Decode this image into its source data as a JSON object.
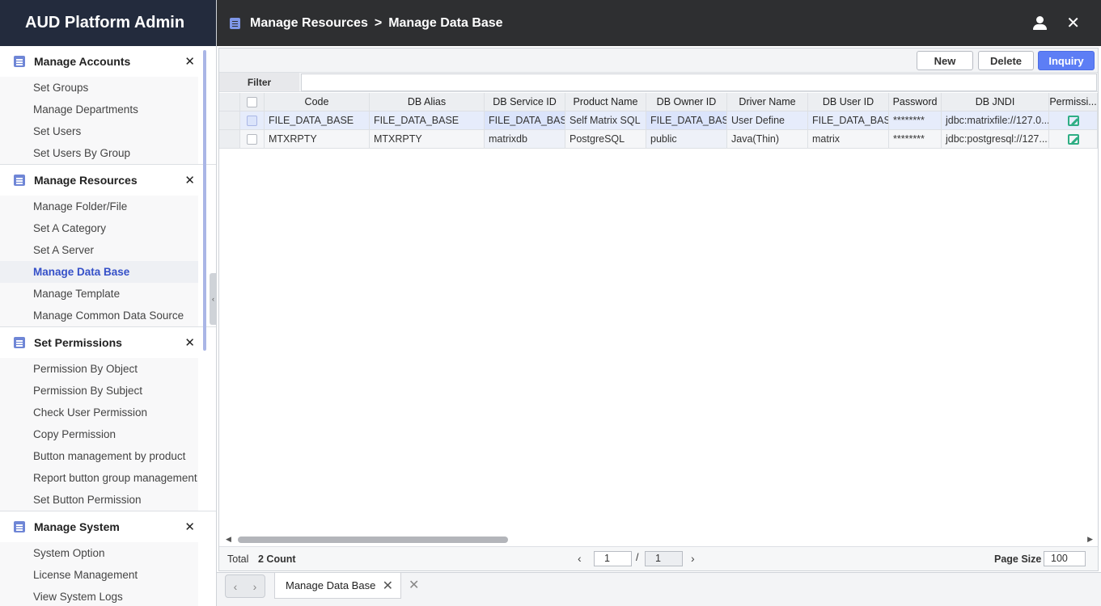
{
  "app": {
    "title": "AUD Platform Admin"
  },
  "header": {
    "breadcrumb": [
      "Manage Resources",
      "Manage Data Base"
    ],
    "separator": ">",
    "icons": {
      "user": "user-icon",
      "close": "close-icon"
    }
  },
  "sidebar": {
    "groups": [
      {
        "title": "Manage Accounts",
        "items": [
          "Set Groups",
          "Manage Departments",
          "Set Users",
          "Set Users By Group"
        ]
      },
      {
        "title": "Manage Resources",
        "items": [
          "Manage Folder/File",
          "Set A Category",
          "Set A Server",
          "Manage Data Base",
          "Manage Template",
          "Manage Common Data Source"
        ]
      },
      {
        "title": "Set Permissions",
        "items": [
          "Permission By Object",
          "Permission By Subject",
          "Check User Permission",
          "Copy Permission",
          "Button management by product",
          "Report button group management",
          "Set Button Permission"
        ]
      },
      {
        "title": "Manage System",
        "items": [
          "System Option",
          "License Management",
          "View System Logs"
        ]
      }
    ],
    "active_item": "Manage Data Base",
    "close_glyph": "✕"
  },
  "toolbar": {
    "new_label": "New",
    "delete_label": "Delete",
    "inquiry_label": "Inquiry"
  },
  "filter": {
    "label": "Filter",
    "value": ""
  },
  "grid": {
    "columns": [
      "",
      "",
      "Code",
      "DB Alias",
      "DB Service ID",
      "Product Name",
      "DB Owner ID",
      "Driver Name",
      "DB User ID",
      "Password",
      "DB JNDI",
      "Permissi..."
    ],
    "rows": [
      [
        "FILE_DATA_BASE",
        "FILE_DATA_BASE",
        "FILE_DATA_BASE",
        "Self Matrix SQL",
        "FILE_DATA_BASE",
        "User Define",
        "FILE_DATA_BASE",
        "********",
        "jdbc:matrixfile://127.0...."
      ],
      [
        "MTXRPTY",
        "MTXRPTY",
        "matrixdb",
        "PostgreSQL",
        "public",
        "Java(Thin)",
        "matrix",
        "********",
        "jdbc:postgresql://127...."
      ]
    ],
    "permission_icon": "edit-icon"
  },
  "status": {
    "total_label": "Total",
    "total_count": "2 Count",
    "current_page": "1",
    "page_separator": "/",
    "total_pages": "1",
    "page_size_label": "Page Size",
    "page_size": "100"
  },
  "tabs": {
    "active_label": "Manage Data Base"
  },
  "colors": {
    "brand_bg": "#232b3d",
    "header_bg": "#2e2f31",
    "accent": "#5d7ef5",
    "active_text": "#3550c8",
    "edit_icon": "#2fae84"
  }
}
